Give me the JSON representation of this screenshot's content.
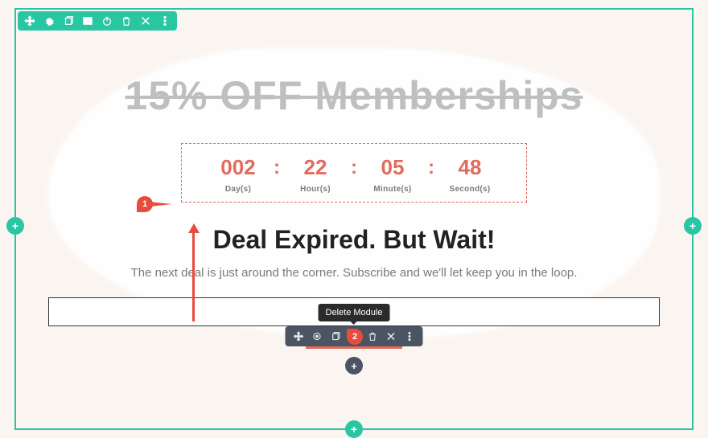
{
  "headline_strike": "15% OFF Memberships",
  "countdown": {
    "days": {
      "value": "002",
      "label": "Day(s)"
    },
    "hours": {
      "value": "22",
      "label": "Hour(s)"
    },
    "minutes": {
      "value": "05",
      "label": "Minute(s)"
    },
    "seconds": {
      "value": "48",
      "label": "Second(s)"
    },
    "sep": ":"
  },
  "expired_title": "Deal Expired. But Wait!",
  "sub_text": "The next deal is just around the corner. Subscribe and we'll let keep you in the loop.",
  "tooltip": "Delete Module",
  "callouts": {
    "one": "1",
    "two": "2"
  },
  "icons": {
    "move": "move-icon",
    "gear": "gear-icon",
    "duplicate": "duplicate-icon",
    "columns": "columns-icon",
    "power": "power-icon",
    "trash": "trash-icon",
    "close": "close-icon",
    "more": "more-icon",
    "save": "save-icon"
  }
}
